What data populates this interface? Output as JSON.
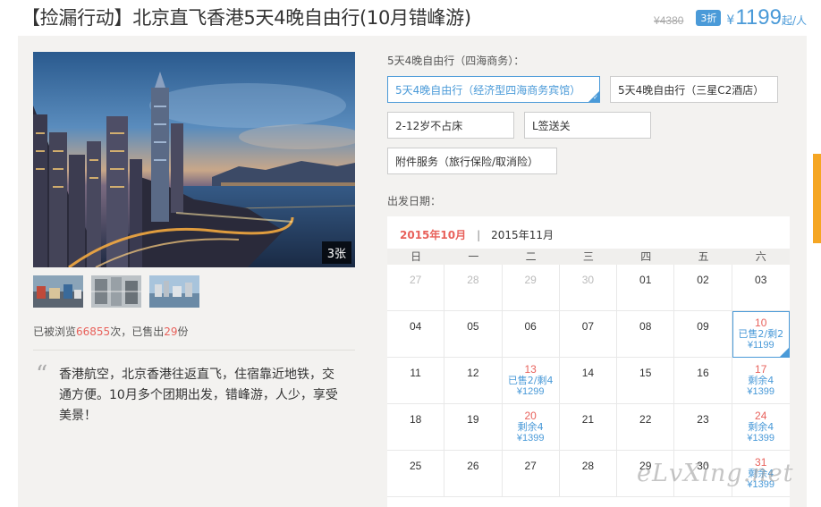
{
  "header": {
    "title": "【捡漏行动】北京直飞香港5天4晚自由行(10月错峰游)",
    "old_price": "¥4380",
    "discount": "3折",
    "currency": "¥",
    "price": "1199",
    "unit": "起/人"
  },
  "gallery": {
    "photo_count": "3张",
    "thumbnails": [
      "street-market-thumb",
      "building-interior-thumb",
      "harbor-city-thumb"
    ]
  },
  "stats": {
    "prefix": "已被浏览",
    "views": "66855",
    "middle": "次，已售出",
    "sold": "29",
    "suffix": "份"
  },
  "description": "香港航空，北京香港往返直飞，住宿靠近地铁，交通方便。10月多个团期出发，错峰游，人少，享受美景！",
  "package": {
    "label": "5天4晚自由行（四海商务）：",
    "options": [
      "5天4晚自由行（经济型四海商务宾馆）",
      "5天4晚自由行（三星C2酒店）",
      "2-12岁不占床",
      "L签送关",
      "附件服务（旅行保险/取消险）"
    ]
  },
  "calendar": {
    "label": "出发日期：",
    "months": [
      "2015年10月",
      "2015年11月"
    ],
    "separator": "|",
    "weekdays": [
      "日",
      "一",
      "二",
      "三",
      "四",
      "五",
      "六"
    ],
    "weeks": [
      [
        {
          "d": "27",
          "m": true
        },
        {
          "d": "28",
          "m": true
        },
        {
          "d": "29",
          "m": true
        },
        {
          "d": "30",
          "m": true
        },
        {
          "d": "01"
        },
        {
          "d": "02"
        },
        {
          "d": "03"
        }
      ],
      [
        {
          "d": "04"
        },
        {
          "d": "05"
        },
        {
          "d": "06"
        },
        {
          "d": "07"
        },
        {
          "d": "08"
        },
        {
          "d": "09"
        },
        {
          "d": "10",
          "info": "已售2/剩2",
          "price": "¥1199",
          "sel": true
        }
      ],
      [
        {
          "d": "11"
        },
        {
          "d": "12"
        },
        {
          "d": "13",
          "info": "已售2/剩4",
          "price": "¥1299"
        },
        {
          "d": "14"
        },
        {
          "d": "15"
        },
        {
          "d": "16"
        },
        {
          "d": "17",
          "info": "剩余4",
          "price": "¥1399"
        }
      ],
      [
        {
          "d": "18"
        },
        {
          "d": "19"
        },
        {
          "d": "20",
          "info": "剩余4",
          "price": "¥1399"
        },
        {
          "d": "21"
        },
        {
          "d": "22"
        },
        {
          "d": "23"
        },
        {
          "d": "24",
          "info": "剩余4",
          "price": "¥1399"
        }
      ],
      [
        {
          "d": "25"
        },
        {
          "d": "26"
        },
        {
          "d": "27"
        },
        {
          "d": "28"
        },
        {
          "d": "29"
        },
        {
          "d": "30"
        },
        {
          "d": "31",
          "info": "剩余4",
          "price": "¥1399"
        }
      ]
    ]
  },
  "watermark": "eLvXing.net",
  "colors": {
    "accent_blue": "#4a9ad8",
    "accent_red": "#e8615b",
    "panel_bg": "#f3f2f0",
    "side_tab": "#f5a623"
  }
}
